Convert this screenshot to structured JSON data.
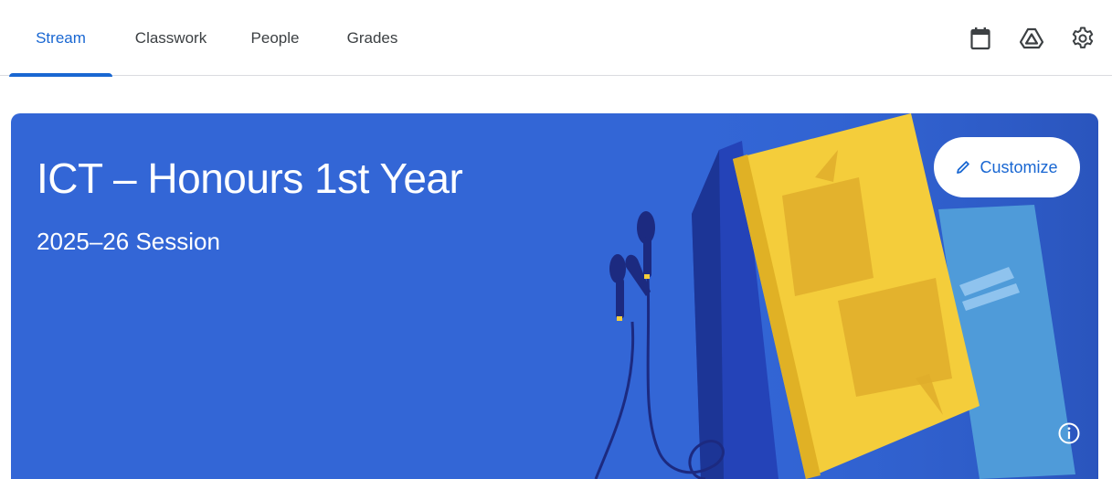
{
  "tabs": [
    {
      "label": "Stream",
      "active": true
    },
    {
      "label": "Classwork",
      "active": false
    },
    {
      "label": "People",
      "active": false
    },
    {
      "label": "Grades",
      "active": false
    }
  ],
  "top_icons": [
    "calendar-icon",
    "drive-icon",
    "settings-gear-icon"
  ],
  "banner": {
    "title": "ICT – Honours 1st Year",
    "section": "2025–26 Session",
    "customize_label": "Customize",
    "background_color": "#3366d6",
    "info_icon": "info-icon"
  },
  "colors": {
    "accent": "#1967d2",
    "tab_text": "#3c4043",
    "divider": "#dadce0"
  }
}
